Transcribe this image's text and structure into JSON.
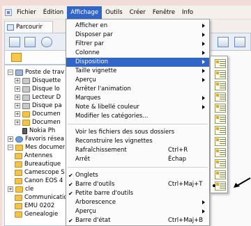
{
  "menubar": {
    "items": [
      "Fichier",
      "Édition",
      "Affichage",
      "Outils",
      "Créer",
      "Fenêtre",
      "Info"
    ],
    "active": "Affichage"
  },
  "left_pane": {
    "tab_label": "Parcourir",
    "tree": [
      {
        "label": "Poste de travail",
        "icon": "computer-icon"
      },
      {
        "label": "Disquette",
        "icon": "floppy-icon"
      },
      {
        "label": "Disque local",
        "icon": "disk-icon"
      },
      {
        "label": "Lecteur DVD",
        "icon": "dvd-icon"
      },
      {
        "label": "Disque partagé",
        "icon": "disk-icon"
      },
      {
        "label": "Documents",
        "icon": "folder-icon"
      },
      {
        "label": "Documents partagés",
        "icon": "folder-icon"
      },
      {
        "label": "Nokia Phone",
        "icon": "phone-icon"
      },
      {
        "label": "Favoris réseau",
        "icon": "network-icon"
      },
      {
        "label": "Mes documents",
        "icon": "folder-icon"
      },
      {
        "label": "Antennes",
        "icon": "folder-icon"
      },
      {
        "label": "Bureautique",
        "icon": "folder-icon"
      },
      {
        "label": "Camescope S",
        "icon": "folder-icon"
      },
      {
        "label": "Canon EOS 4",
        "icon": "folder-icon"
      },
      {
        "label": "cle",
        "icon": "folder-icon"
      },
      {
        "label": "Communication",
        "icon": "folder-icon"
      },
      {
        "label": "EMU 0202",
        "icon": "folder-icon"
      },
      {
        "label": "Genealogie",
        "icon": "folder-icon"
      }
    ],
    "tree_visible": [
      "Poste de trav",
      "Disquette",
      "Disque lo",
      "Lecteur D",
      "Disque pa",
      "Documen",
      "Documen",
      "Nokia Ph",
      "Favoris résea",
      "Mes documer",
      "Antennes",
      "Bureautique",
      "Camescope S",
      "Canon EOS 4",
      "cle",
      "Communicatio",
      "EMU 0202",
      "Genealogie"
    ]
  },
  "affichage_menu": {
    "items": [
      {
        "label": "Afficher en",
        "submenu": true
      },
      {
        "label": "Disposer par",
        "submenu": true
      },
      {
        "label": "Filtrer par",
        "submenu": true
      },
      {
        "label": "Colonne",
        "submenu": true
      },
      {
        "label": "Disposition",
        "submenu": true,
        "highlighted": true
      },
      {
        "label": "Taille vignette",
        "submenu": true
      },
      {
        "label": "Aperçu",
        "submenu": true
      },
      {
        "label": "Arrêter l'animation"
      },
      {
        "label": "Marques",
        "submenu": true
      },
      {
        "label": "Note & libellé couleur",
        "submenu": true
      },
      {
        "label": "Modifier les catégories..."
      },
      {
        "label": "Voir les fichiers des sous dossiers"
      },
      {
        "label": "Reconstruire les vignettes"
      },
      {
        "label": "Rafraîchissement",
        "shortcut": "Ctrl+R"
      },
      {
        "label": "Arrêt",
        "shortcut": "Échap"
      },
      {
        "label": "Onglets",
        "checked": true
      },
      {
        "label": "Barre d'outils",
        "checked": true,
        "shortcut": "Ctrl+Maj+T"
      },
      {
        "label": "Petite barre d'outils",
        "checked": true
      },
      {
        "label": "Arborescence",
        "submenu": true
      },
      {
        "label": "Aperçu",
        "submenu": true
      },
      {
        "label": "Barre d'état",
        "checked": true,
        "shortcut": "Ctrl+Maj+B"
      }
    ]
  },
  "disposition_submenu": {
    "layout_count": 12,
    "selected_index": 11
  },
  "colors": {
    "highlight": "#3165c8",
    "menu_bg": "#fbfbfb",
    "frame": "#f1dcd8"
  }
}
